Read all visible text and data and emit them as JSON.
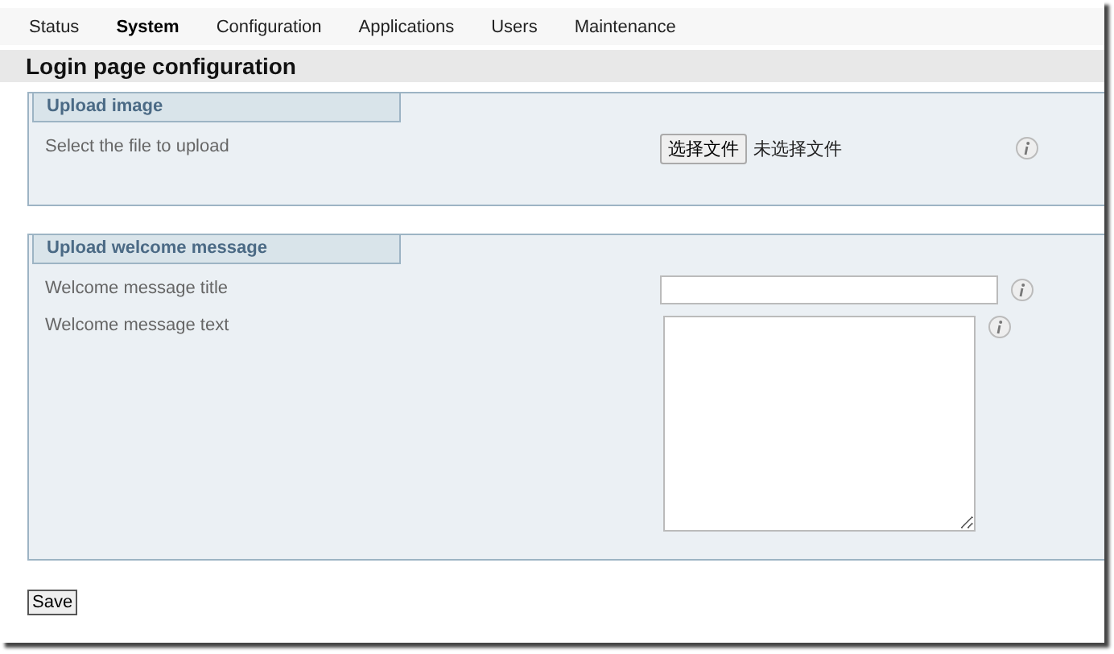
{
  "tabs": [
    {
      "label": "Status",
      "selected": false
    },
    {
      "label": "System",
      "selected": true
    },
    {
      "label": "Configuration",
      "selected": false
    },
    {
      "label": "Applications",
      "selected": false
    },
    {
      "label": "Users",
      "selected": false
    },
    {
      "label": "Maintenance",
      "selected": false
    }
  ],
  "page_title": "Login page configuration",
  "sections": [
    {
      "legend": "Upload image",
      "fields": [
        {
          "kind": "file",
          "label": "Select the file to upload",
          "button": "选择文件",
          "status": "未选择文件"
        }
      ]
    },
    {
      "legend": "Upload welcome message",
      "fields": [
        {
          "kind": "text",
          "label": "Welcome message title"
        },
        {
          "kind": "textarea",
          "label": "Welcome message text"
        }
      ]
    }
  ],
  "save_button": "Save"
}
